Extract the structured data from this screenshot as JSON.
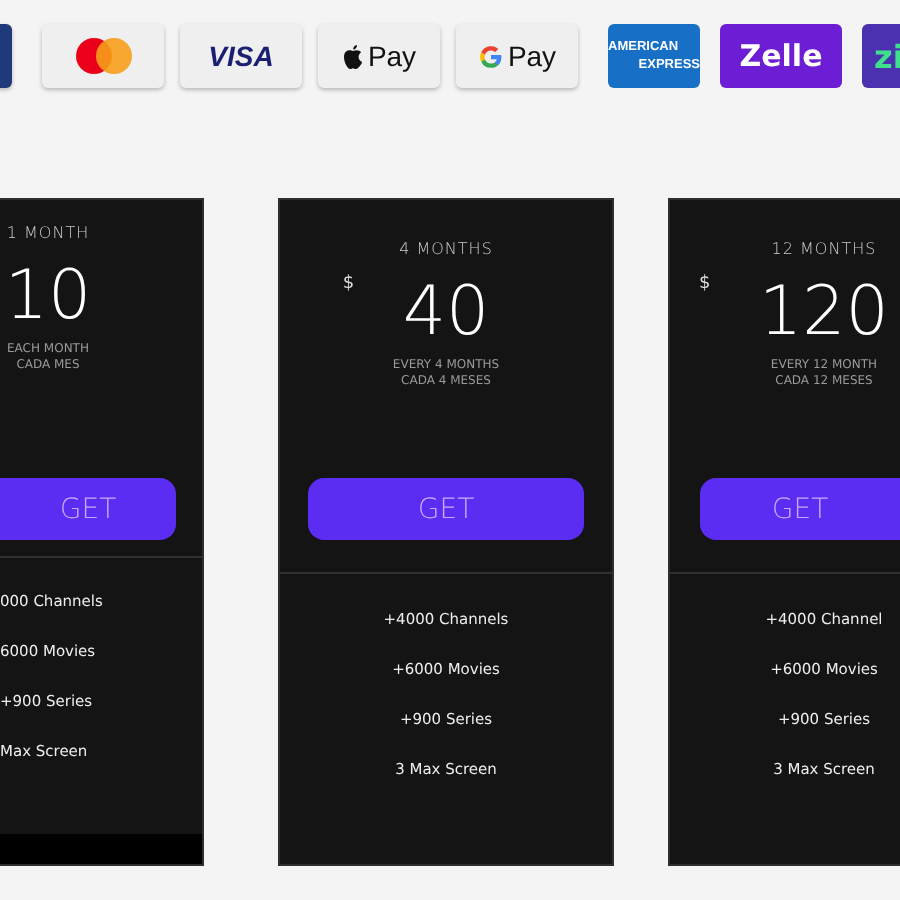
{
  "payment_methods": [
    {
      "kind": "blank"
    },
    {
      "kind": "mastercard"
    },
    {
      "kind": "visa",
      "label": "VISA"
    },
    {
      "kind": "applepay",
      "label": "Pay"
    },
    {
      "kind": "gpay",
      "label": "Pay"
    },
    {
      "kind": "amex",
      "lines": [
        "AMERICAN",
        "EXPRESS"
      ]
    },
    {
      "kind": "zelle",
      "label": "Zelle"
    },
    {
      "kind": "zip",
      "label": "zi"
    }
  ],
  "plans": [
    {
      "kind": "cut_left",
      "title": "1 MONTH",
      "price": "10",
      "billing": [
        "EACH MONTH",
        "CADA MES"
      ],
      "button": "GET",
      "features": [
        "000 Channels",
        "6000 Movies",
        "+900 Series",
        "Max Screen"
      ]
    },
    {
      "kind": "full",
      "title": "4 MONTHS",
      "currency": "$",
      "price": "40",
      "billing": [
        "EVERY 4 MONTHS",
        "CADA 4 MESES"
      ],
      "button": "GET",
      "features": [
        "+4000 Channels",
        "+6000 Movies",
        "+900 Series",
        "3 Max Screen"
      ]
    },
    {
      "kind": "cut_right",
      "title": "12 MONTHS",
      "currency": "$",
      "price": "120",
      "billing": [
        "EVERY 12 MONTH",
        "CADA 12 MESES"
      ],
      "button": "GET",
      "features": [
        "+4000 Channel",
        "+6000 Movies",
        "+900 Series",
        "3 Max Screen"
      ]
    }
  ]
}
